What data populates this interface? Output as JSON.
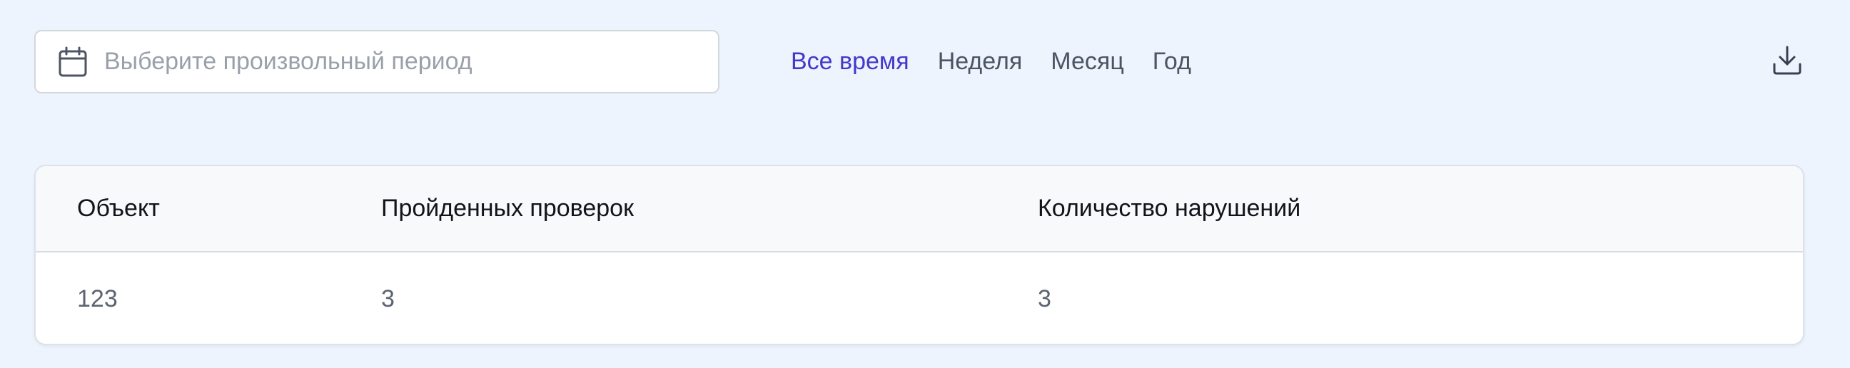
{
  "toolbar": {
    "date_picker": {
      "icon": "calendar-icon",
      "placeholder": "Выберите произвольный период",
      "value": ""
    },
    "period_tabs": [
      {
        "label": "Все время",
        "active": true
      },
      {
        "label": "Неделя",
        "active": false
      },
      {
        "label": "Месяц",
        "active": false
      },
      {
        "label": "Год",
        "active": false
      }
    ],
    "download_icon": "download-icon"
  },
  "table": {
    "columns": [
      "Объект",
      "Пройденных проверок",
      "Количество нарушений"
    ],
    "rows": [
      [
        "123",
        "3",
        "3"
      ]
    ]
  },
  "colors": {
    "background": "#eef4fd",
    "active_tab": "#4338ca",
    "inactive_tab": "#4b5563",
    "placeholder": "#9aa0aa"
  }
}
